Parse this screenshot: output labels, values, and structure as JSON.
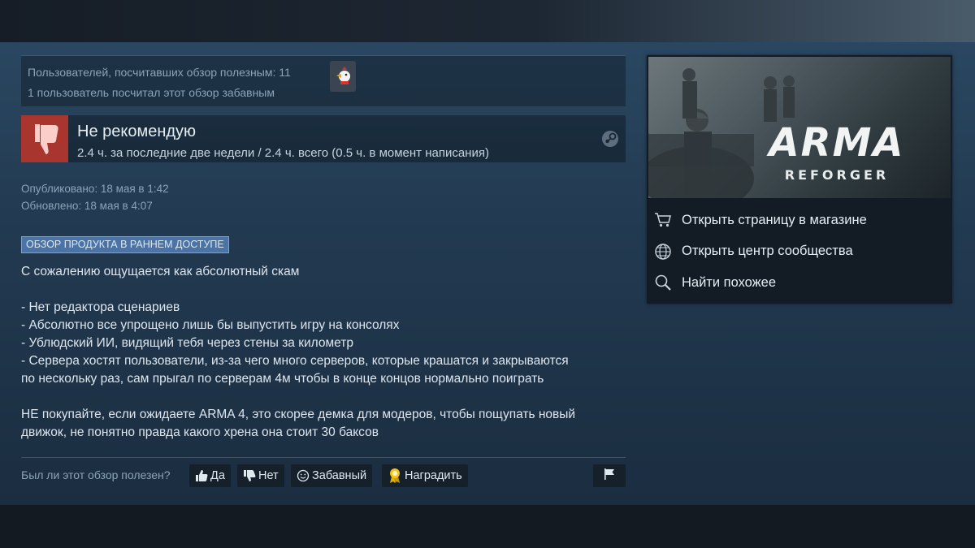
{
  "votes": {
    "helpful_text": "Пользователей, посчитавших обзор полезным: 11",
    "funny_text": "1 пользователь посчитал этот обзор забавным",
    "award_icon": "award-chicken-icon"
  },
  "review": {
    "verdict": "Не рекомендую",
    "hours": "2.4 ч. за последние две недели / 2.4 ч. всего (0.5 ч. в момент написания)",
    "published": "Опубликовано: 18 мая в 1:42",
    "updated": "Обновлено: 18 мая в 4:07",
    "badge": "ОБЗОР ПРОДУКТА В РАННЕМ ДОСТУПЕ",
    "body": [
      "С сожалению ощущается как абсолютный скам",
      "",
      "- Нет редактора сценариев",
      "- Абсолютно все упрощено лишь бы выпустить игру на консолях",
      "- Ублюдский ИИ, видящий тебя через стены за километр",
      "- Сервера хостят пользователи, из-за чего много серверов, которые крашатся и закрываются",
      "по нескольку раз, сам прыгал по серверам 4м чтобы в конце концов нормально поиграть",
      "",
      "НЕ покупайте, если ожидаете ARMA 4, это скорее демка для модеров, чтобы пощупать новый",
      "движок, не понятно правда какого хрена она стоит 30 баксов"
    ]
  },
  "footer": {
    "question": "Был ли этот обзор полезен?",
    "yes": "Да",
    "no": "Нет",
    "funny": "Забавный",
    "award": "Наградить"
  },
  "game": {
    "logo_title": "ARMA",
    "logo_subtitle": "REFORGER",
    "links": [
      {
        "label": "Открыть страницу в магазине",
        "icon": "cart-icon"
      },
      {
        "label": "Открыть центр сообщества",
        "icon": "globe-icon"
      },
      {
        "label": "Найти похожее",
        "icon": "search-icon"
      }
    ]
  },
  "colors": {
    "background": "#1b2838",
    "thumb_down": "#a8362e",
    "badge": "#4b73a5"
  }
}
